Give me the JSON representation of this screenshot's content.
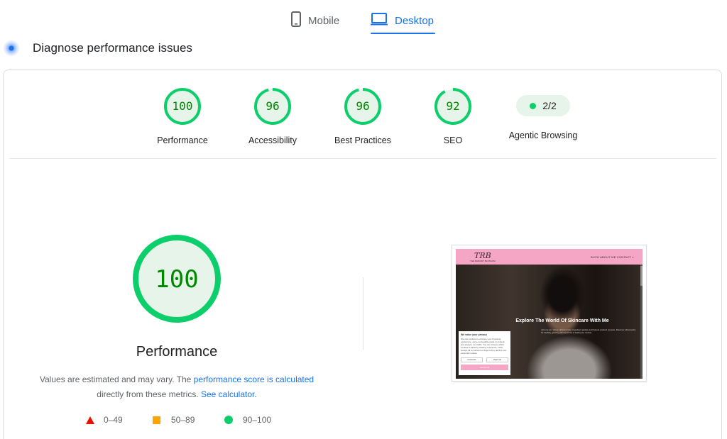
{
  "tabs": {
    "mobile": {
      "label": "Mobile",
      "icon": "phone-icon"
    },
    "desktop": {
      "label": "Desktop",
      "icon": "monitor-icon",
      "active": true
    }
  },
  "section": {
    "title": "Diagnose performance issues",
    "icon": "diagnose-icon"
  },
  "scores": [
    {
      "label": "Performance",
      "value": "100"
    },
    {
      "label": "Accessibility",
      "value": "96"
    },
    {
      "label": "Best Practices",
      "value": "96"
    },
    {
      "label": "SEO",
      "value": "92"
    }
  ],
  "agentic": {
    "label": "Agentic Browsing",
    "value": "2/2"
  },
  "main": {
    "score": "100",
    "title": "Performance",
    "desc_prefix": "Values are estimated and may vary. The ",
    "link_score": "performance score is calculated",
    "desc_middle": "directly from these metrics. ",
    "link_calc": "See calculator",
    "desc_suffix": "."
  },
  "legend": [
    {
      "range": "0–49",
      "shape": "triangle",
      "color": "#eb0f00"
    },
    {
      "range": "50–89",
      "shape": "square",
      "color": "#ffa400"
    },
    {
      "range": "90–100",
      "shape": "circle",
      "color": "#0cce6b"
    }
  ],
  "thumbnail": {
    "logo": "TRB",
    "logo_sub": "THE RADIANT BLOSSOM",
    "nav_links": "BLOG   ABOUT ME   CONTACT   ⌕",
    "hero_title": "Explore The World Of Skincare With Me",
    "hero_sub": "Join me as I share skincare tips, ingredient guides and honest product reviews. Discover what works for healthy, glowing skin and how to build your routine.",
    "cookie_title": "We value your privacy",
    "cookie_text": "We use cookies to enhance your browsing experience, serve personalized ads or content, and analyze our traffic. You can choose which cookies to allow by clicking Customize. Click Accept All to consent or Reject All to decline non-essential cookies.",
    "cookie_customize": "Customize",
    "cookie_reject": "Reject All",
    "cookie_accept": "Accept All"
  },
  "colors": {
    "pass": "#0cce6b",
    "pass_bg": "#e6f4ea",
    "pass_text": "#008800",
    "accent": "#1a73e8"
  }
}
